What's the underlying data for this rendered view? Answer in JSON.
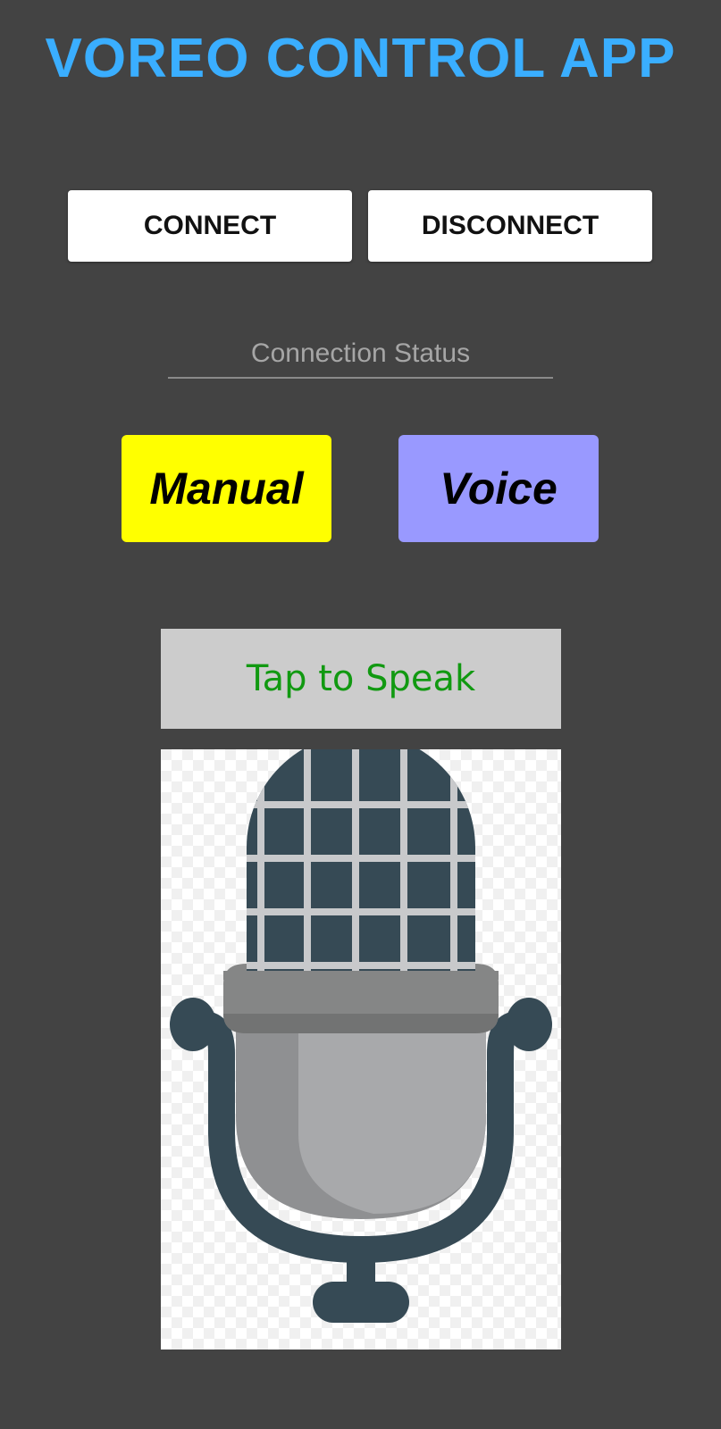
{
  "app": {
    "title": "VOREO CONTROL APP"
  },
  "connection": {
    "connect_label": "CONNECT",
    "disconnect_label": "DISCONNECT",
    "status_placeholder": "Connection Status"
  },
  "modes": {
    "manual_label": "Manual",
    "voice_label": "Voice"
  },
  "voice": {
    "speak_label": "Tap to Speak",
    "mic_icon": "microphone-icon"
  },
  "colors": {
    "background": "#434343",
    "title": "#3aaeff",
    "manual_button": "#ffff00",
    "voice_button": "#9999ff",
    "speak_button": "#cccccc",
    "speak_text": "#119911"
  }
}
